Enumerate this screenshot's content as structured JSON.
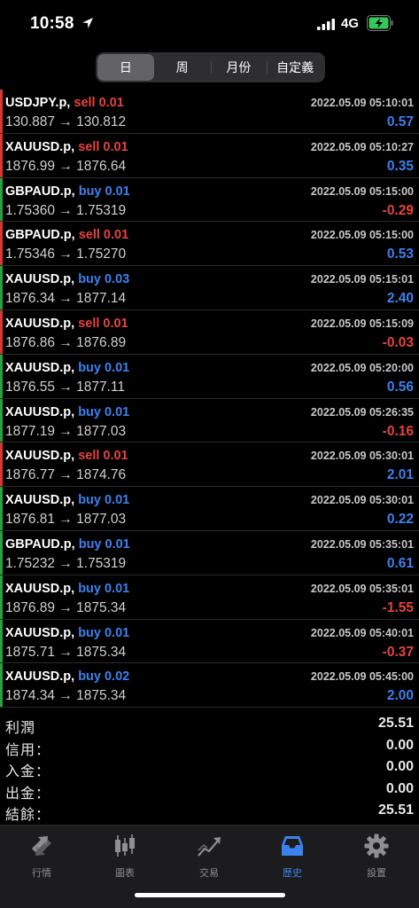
{
  "status_bar": {
    "time": "10:58",
    "network": "4G"
  },
  "segments": [
    {
      "label": "日",
      "active": true
    },
    {
      "label": "周",
      "active": false
    },
    {
      "label": "月份",
      "active": false
    },
    {
      "label": "自定義",
      "active": false
    }
  ],
  "trades": [
    {
      "symbol": "USDJPY.p,",
      "side": "sell",
      "lots": "sell 0.01",
      "prices": "130.887 → 130.812",
      "datetime": "2022.05.09 05:10:01",
      "profit": "0.57"
    },
    {
      "symbol": "XAUUSD.p,",
      "side": "sell",
      "lots": "sell 0.01",
      "prices": "1876.99 → 1876.64",
      "datetime": "2022.05.09 05:10:27",
      "profit": "0.35"
    },
    {
      "symbol": "GBPAUD.p,",
      "side": "buy",
      "lots": "buy 0.01",
      "prices": "1.75360 → 1.75319",
      "datetime": "2022.05.09 05:15:00",
      "profit": "-0.29"
    },
    {
      "symbol": "GBPAUD.p,",
      "side": "sell",
      "lots": "sell 0.01",
      "prices": "1.75346 → 1.75270",
      "datetime": "2022.05.09 05:15:00",
      "profit": "0.53"
    },
    {
      "symbol": "XAUUSD.p,",
      "side": "buy",
      "lots": "buy 0.03",
      "prices": "1876.34 → 1877.14",
      "datetime": "2022.05.09 05:15:01",
      "profit": "2.40"
    },
    {
      "symbol": "XAUUSD.p,",
      "side": "sell",
      "lots": "sell 0.01",
      "prices": "1876.86 → 1876.89",
      "datetime": "2022.05.09 05:15:09",
      "profit": "-0.03"
    },
    {
      "symbol": "XAUUSD.p,",
      "side": "buy",
      "lots": "buy 0.01",
      "prices": "1876.55 → 1877.11",
      "datetime": "2022.05.09 05:20:00",
      "profit": "0.56"
    },
    {
      "symbol": "XAUUSD.p,",
      "side": "buy",
      "lots": "buy 0.01",
      "prices": "1877.19 → 1877.03",
      "datetime": "2022.05.09 05:26:35",
      "profit": "-0.16"
    },
    {
      "symbol": "XAUUSD.p,",
      "side": "sell",
      "lots": "sell 0.01",
      "prices": "1876.77 → 1874.76",
      "datetime": "2022.05.09 05:30:01",
      "profit": "2.01"
    },
    {
      "symbol": "XAUUSD.p,",
      "side": "buy",
      "lots": "buy 0.01",
      "prices": "1876.81 → 1877.03",
      "datetime": "2022.05.09 05:30:01",
      "profit": "0.22"
    },
    {
      "symbol": "GBPAUD.p,",
      "side": "buy",
      "lots": "buy 0.01",
      "prices": "1.75232 → 1.75319",
      "datetime": "2022.05.09 05:35:01",
      "profit": "0.61"
    },
    {
      "symbol": "XAUUSD.p,",
      "side": "buy",
      "lots": "buy 0.01",
      "prices": "1876.89 → 1875.34",
      "datetime": "2022.05.09 05:35:01",
      "profit": "-1.55"
    },
    {
      "symbol": "XAUUSD.p,",
      "side": "buy",
      "lots": "buy 0.01",
      "prices": "1875.71 → 1875.34",
      "datetime": "2022.05.09 05:40:01",
      "profit": "-0.37"
    },
    {
      "symbol": "XAUUSD.p,",
      "side": "buy",
      "lots": "buy 0.02",
      "prices": "1874.34 → 1875.34",
      "datetime": "2022.05.09 05:45:00",
      "profit": "2.00"
    }
  ],
  "summary": [
    {
      "label": "利潤",
      "value": "25.51"
    },
    {
      "label": "信用：",
      "value": "0.00"
    },
    {
      "label": "入金：",
      "value": "0.00"
    },
    {
      "label": "出金：",
      "value": "0.00"
    },
    {
      "label": "結餘：",
      "value": "25.51"
    }
  ],
  "tabs": [
    {
      "label": "行情",
      "icon": "quotes-icon",
      "active": false
    },
    {
      "label": "圖表",
      "icon": "chart-icon",
      "active": false
    },
    {
      "label": "交易",
      "icon": "trade-icon",
      "active": false
    },
    {
      "label": "歷史",
      "icon": "history-icon",
      "active": true
    },
    {
      "label": "設置",
      "icon": "settings-icon",
      "active": false
    }
  ],
  "colors": {
    "buy": "#3b82f0",
    "sell": "#e8433b",
    "buy_edge": "#2aa13e",
    "sell_edge": "#d63a2f",
    "accent": "#3b82f0",
    "battery": "#34c759"
  }
}
